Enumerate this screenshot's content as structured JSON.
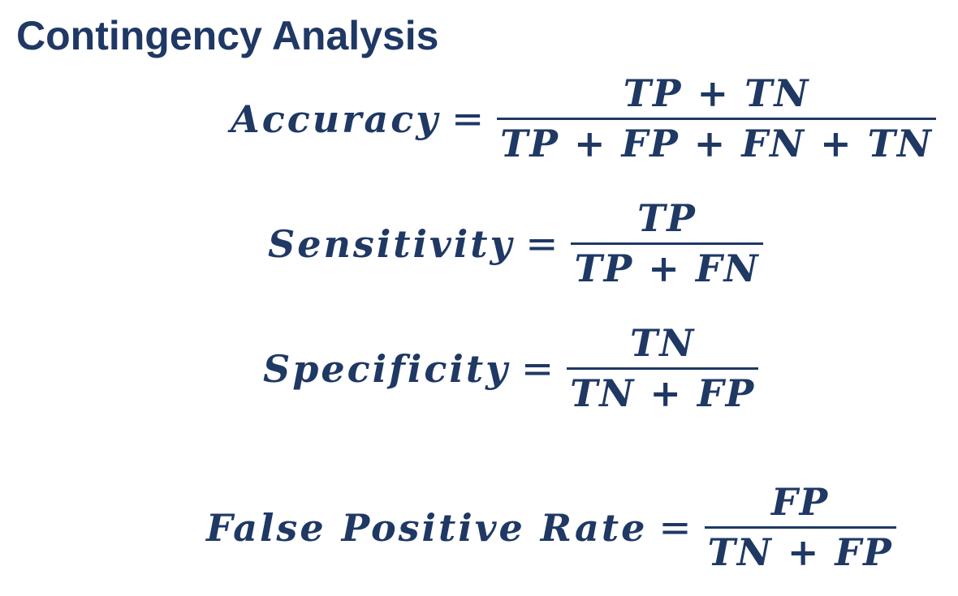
{
  "title": "Contingency Analysis",
  "colors": {
    "text": "#1f3864",
    "background": "#ffffff"
  },
  "formulas": [
    {
      "lhs": "Accuracy",
      "equals": "=",
      "numerator": "TP + TN",
      "denominator": "TP + FP + FN + TN"
    },
    {
      "lhs": "Sensitivity",
      "equals": "=",
      "numerator": "TP",
      "denominator": "TP + FN"
    },
    {
      "lhs": "Specificity",
      "equals": "=",
      "numerator": "TN",
      "denominator": "TN + FP"
    },
    {
      "lhs": "False Positive Rate",
      "equals": "=",
      "numerator": "FP",
      "denominator": "TN + FP"
    }
  ]
}
